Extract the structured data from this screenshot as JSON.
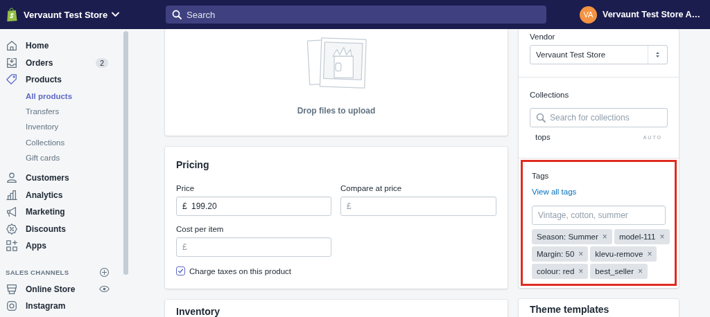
{
  "topbar": {
    "store_name": "Vervaunt Test Store",
    "search": {
      "placeholder": "Search"
    },
    "account": {
      "initials": "VA",
      "name": "Vervaunt Test Store A…"
    }
  },
  "sidebar": {
    "items": [
      {
        "label": "Home",
        "selected": false
      },
      {
        "label": "Orders",
        "badge": "2",
        "selected": false
      },
      {
        "label": "Products",
        "selected": true,
        "children": [
          {
            "label": "All products",
            "selected": true
          },
          {
            "label": "Transfers",
            "selected": false
          },
          {
            "label": "Inventory",
            "selected": false
          },
          {
            "label": "Collections",
            "selected": false
          },
          {
            "label": "Gift cards",
            "selected": false
          }
        ]
      },
      {
        "label": "Customers",
        "selected": false
      },
      {
        "label": "Analytics",
        "selected": false
      },
      {
        "label": "Marketing",
        "selected": false
      },
      {
        "label": "Discounts",
        "selected": false
      },
      {
        "label": "Apps",
        "selected": false
      }
    ],
    "section": {
      "title": "SALES CHANNELS",
      "items": [
        {
          "label": "Online Store",
          "selected": false
        },
        {
          "label": "Instagram",
          "selected": false
        }
      ]
    }
  },
  "media": {
    "drop_text": "Drop files to upload"
  },
  "pricing": {
    "title": "Pricing",
    "fields": [
      {
        "label": "Price",
        "prefix": "£",
        "value": "199.20"
      },
      {
        "label": "Compare at price",
        "prefix": "£"
      },
      {
        "label": "Cost per item",
        "prefix": "£"
      }
    ],
    "checkbox": {
      "label": "Charge taxes on this product",
      "checked": true
    }
  },
  "inventory": {
    "title": "Inventory"
  },
  "organization": {
    "vendor": {
      "label": "Vendor",
      "value": "Vervaunt Test Store"
    },
    "collections": {
      "label": "Collections",
      "search": {
        "placeholder": "Search for collections"
      },
      "items": [
        {
          "name": "tops",
          "badge": "AUTO"
        }
      ]
    },
    "tags": {
      "label": "Tags",
      "link": "View all tags",
      "input": {
        "placeholder": "Vintage, cotton, summer"
      },
      "tags": [
        {
          "label": "Season: Summer",
          "remove": "×"
        },
        {
          "label": "model-111",
          "remove": "×"
        },
        {
          "label": "Margin: 50",
          "remove": "×"
        },
        {
          "label": "klevu-remove",
          "remove": "×"
        },
        {
          "label": "colour: red",
          "remove": "×"
        },
        {
          "label": "best_seller",
          "remove": "×"
        }
      ]
    }
  },
  "theme_templates": {
    "title": "Theme templates"
  }
}
